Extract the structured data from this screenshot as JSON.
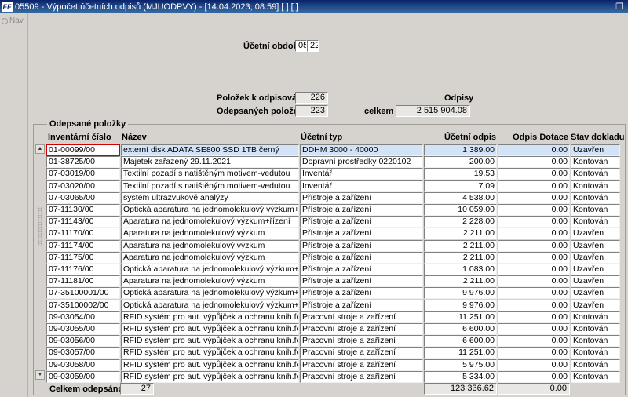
{
  "window": {
    "title": "05509 - Výpočet účetních odpisů (MJUODPVY) - [14.04.2023; 08:59] [ ] [ ]",
    "app_icon": "FF"
  },
  "nav": {
    "label": "Nav"
  },
  "period": {
    "label": "Účetní období",
    "month": "05",
    "year": "22"
  },
  "summary": {
    "to_depreciate_label": "Položek k odpisování",
    "to_depreciate_value": "226",
    "depreciated_label": "Odepsaných položek",
    "depreciated_value": "223",
    "odpisy_label": "Odpisy",
    "celkem_label": "celkem",
    "celkem_value": "2 515 904.08"
  },
  "group": {
    "title": "Odepsané položky"
  },
  "columns": {
    "inv": "Inventární číslo",
    "name": "Název",
    "type": "Účetní typ",
    "odpis": "Účetní odpis",
    "dotace": "Odpis Dotace",
    "stav": "Stav dokladu"
  },
  "rows": [
    {
      "inv": "01-00099/00",
      "name": "externí disk ADATA SE800 SSD 1TB černý",
      "type": "DDHM 3000 - 40000",
      "odpis": "1 389.00",
      "dotace": "0.00",
      "stav": "Uzavřen"
    },
    {
      "inv": "01-38725/00",
      "name": "Majetek zařazený 29.11.2021",
      "type": "Dopravní prostředky 0220102",
      "odpis": "200.00",
      "dotace": "0.00",
      "stav": "Kontován"
    },
    {
      "inv": "07-03019/00",
      "name": "Textilní pozadí s natištěným motivem-vedutou",
      "type": "Inventář",
      "odpis": "19.53",
      "dotace": "0.00",
      "stav": "Kontován"
    },
    {
      "inv": "07-03020/00",
      "name": "Textilní pozadí s natištěným motivem-vedutou",
      "type": "Inventář",
      "odpis": "7.09",
      "dotace": "0.00",
      "stav": "Kontován"
    },
    {
      "inv": "07-03065/00",
      "name": "systém ultrazvukové analýzy",
      "type": "Přístroje a zařízení",
      "odpis": "4 538.00",
      "dotace": "0.00",
      "stav": "Kontován"
    },
    {
      "inv": "07-11130/00",
      "name": "Optická aparatura na jednomolekulový výzkum+řízení",
      "type": "Přístroje a zařízení",
      "odpis": "10 059.00",
      "dotace": "0.00",
      "stav": "Kontován"
    },
    {
      "inv": "07-11143/00",
      "name": "Aparatura na jednomolekulový výzkum+řízení",
      "type": "Přístroje a zařízení",
      "odpis": "2 228.00",
      "dotace": "0.00",
      "stav": "Kontován"
    },
    {
      "inv": "07-11170/00",
      "name": "Aparatura na jednomolekulový výzkum",
      "type": "Přístroje a zařízení",
      "odpis": "2 211.00",
      "dotace": "0.00",
      "stav": "Uzavřen"
    },
    {
      "inv": "07-11174/00",
      "name": "Aparatura na jednomolekulový výzkum",
      "type": "Přístroje a zařízení",
      "odpis": "2 211.00",
      "dotace": "0.00",
      "stav": "Uzavřen"
    },
    {
      "inv": "07-11175/00",
      "name": "Aparatura na jednomolekulový výzkum",
      "type": "Přístroje a zařízení",
      "odpis": "2 211.00",
      "dotace": "0.00",
      "stav": "Uzavřen"
    },
    {
      "inv": "07-11176/00",
      "name": "Optická aparatura na jednomolekulový výzkum+řízení",
      "type": "Přístroje a zařízení",
      "odpis": "1 083.00",
      "dotace": "0.00",
      "stav": "Uzavřen"
    },
    {
      "inv": "07-11181/00",
      "name": "Aparatura na jednomolekulový výzkum",
      "type": "Přístroje a zařízení",
      "odpis": "2 211.00",
      "dotace": "0.00",
      "stav": "Uzavřen"
    },
    {
      "inv": "07-35100001/00",
      "name": "Optická aparatura na jednomolekulový výzkum+řízení",
      "type": "Přístroje a zařízení",
      "odpis": "9 976.00",
      "dotace": "0.00",
      "stav": "Uzavřen"
    },
    {
      "inv": "07-35100002/00",
      "name": "Optická aparatura na jednomolekulový výzkum+řízení",
      "type": "Přístroje a zařízení",
      "odpis": "9 976.00",
      "dotace": "0.00",
      "stav": "Uzavřen"
    },
    {
      "inv": "09-03054/00",
      "name": "RFID systém pro aut. výpůjček a ochranu knih.fondu",
      "type": "Pracovní stroje a zařízení",
      "odpis": "11 251.00",
      "dotace": "0.00",
      "stav": "Kontován"
    },
    {
      "inv": "09-03055/00",
      "name": "RFID systém pro aut. výpůjček a ochranu knih.fondu",
      "type": "Pracovní stroje a zařízení",
      "odpis": "6 600.00",
      "dotace": "0.00",
      "stav": "Kontován"
    },
    {
      "inv": "09-03056/00",
      "name": "RFID systém pro aut. výpůjček a ochranu knih.fondu",
      "type": "Pracovní stroje a zařízení",
      "odpis": "6 600.00",
      "dotace": "0.00",
      "stav": "Kontován"
    },
    {
      "inv": "09-03057/00",
      "name": "RFID systém pro aut. výpůjček a ochranu knih.fondu",
      "type": "Pracovní stroje a zařízení",
      "odpis": "11 251.00",
      "dotace": "0.00",
      "stav": "Kontován"
    },
    {
      "inv": "09-03058/00",
      "name": "RFID systém pro aut. výpůjček a ochranu knih.fondu",
      "type": "Pracovní stroje a zařízení",
      "odpis": "5 975.00",
      "dotace": "0.00",
      "stav": "Kontován"
    },
    {
      "inv": "09-03059/00",
      "name": "RFID systém pro aut. výpůjček a ochranu knih.fondu",
      "type": "Pracovní stroje a zařízení",
      "odpis": "5 334.00",
      "dotace": "0.00",
      "stav": "Kontován"
    }
  ],
  "footer": {
    "label": "Celkem odepsáno",
    "count": "27",
    "sum_odpis": "123 336.62",
    "sum_dotace": "0.00"
  }
}
